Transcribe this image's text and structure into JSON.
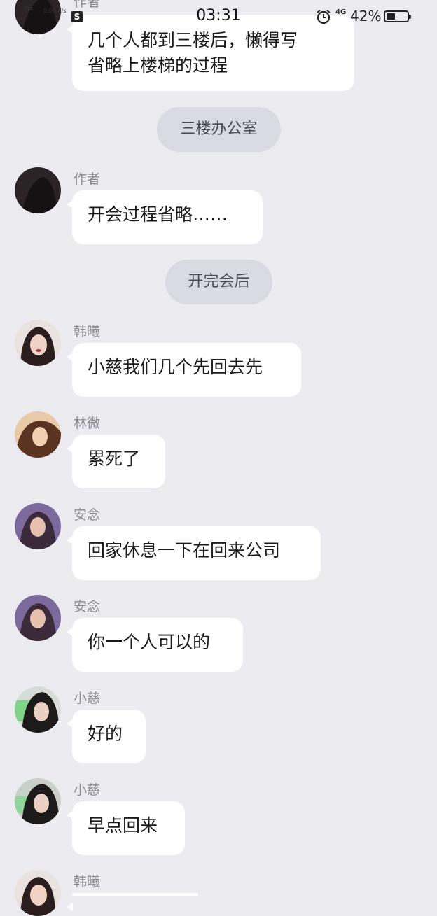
{
  "status_bar": {
    "time": "03:31",
    "network_left": "4G",
    "speed": "0.00 K/s",
    "app_icon": "S",
    "network_right": "4G",
    "battery_percent": "42%",
    "battery_level": 0.42,
    "alarm_icon": "alarm-clock-icon"
  },
  "messages": [
    {
      "type": "chat",
      "sender": "作者",
      "lines": [
        "几个人都到三楼后，懒得写",
        "省略上楼梯的过程"
      ]
    },
    {
      "type": "system",
      "text": "三楼办公室"
    },
    {
      "type": "chat",
      "sender": "作者",
      "lines": [
        "开会过程省略……"
      ]
    },
    {
      "type": "system",
      "text": "开完会后"
    },
    {
      "type": "chat",
      "sender": "韩曦",
      "lines": [
        "小慈我们几个先回去先"
      ]
    },
    {
      "type": "chat",
      "sender": "林微",
      "lines": [
        "累死了"
      ]
    },
    {
      "type": "chat",
      "sender": "安念",
      "lines": [
        "回家休息一下在回来公司"
      ]
    },
    {
      "type": "chat",
      "sender": "安念",
      "lines": [
        "你一个人可以的"
      ]
    },
    {
      "type": "chat",
      "sender": "小慈",
      "lines": [
        "好的"
      ]
    },
    {
      "type": "chat",
      "sender": "小慈",
      "lines": [
        "早点回来"
      ]
    },
    {
      "type": "chat",
      "sender": "韩曦",
      "lines": [
        ""
      ]
    }
  ]
}
